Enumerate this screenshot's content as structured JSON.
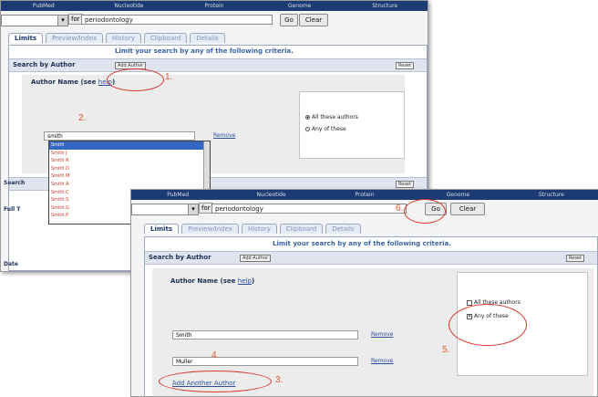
{
  "top_menu": [
    "PubMed",
    "Nucleotide",
    "Protein",
    "Genome",
    "Structure"
  ],
  "search": {
    "db_label": "for",
    "query": "periodontology",
    "go_label": "Go",
    "clear_label": "Clear"
  },
  "tabs": [
    "Limits",
    "Preview/Index",
    "History",
    "Clipboard",
    "Details"
  ],
  "limit_text": "Limit your search by any of the following criteria.",
  "section_title": "Search by Author",
  "add_author_small": "Add Author",
  "reset_label": "Reset",
  "author_name_label": "Author Name (see",
  "help_link": "help",
  "label_close": ")",
  "typed_author": "smith",
  "remove_label": "Remove",
  "dropdown_items": [
    "Smith",
    "Smith J",
    "Smith R",
    "Smith D",
    "Smith M",
    "Smith A",
    "Smith C",
    "Smith S",
    "Smith G",
    "Smith P"
  ],
  "stub_rows": [
    "Search",
    "Full T",
    "Date"
  ],
  "radio_all": "All these authors",
  "radio_any": "Any of these",
  "authors": [
    "Smith",
    "Muller"
  ],
  "add_another_author": "Add Another Author",
  "annotations": [
    "1.",
    "2.",
    "3.",
    "4.",
    "5.",
    "6."
  ],
  "accent": "#1c3a73",
  "annotation_color": "#d9342b"
}
